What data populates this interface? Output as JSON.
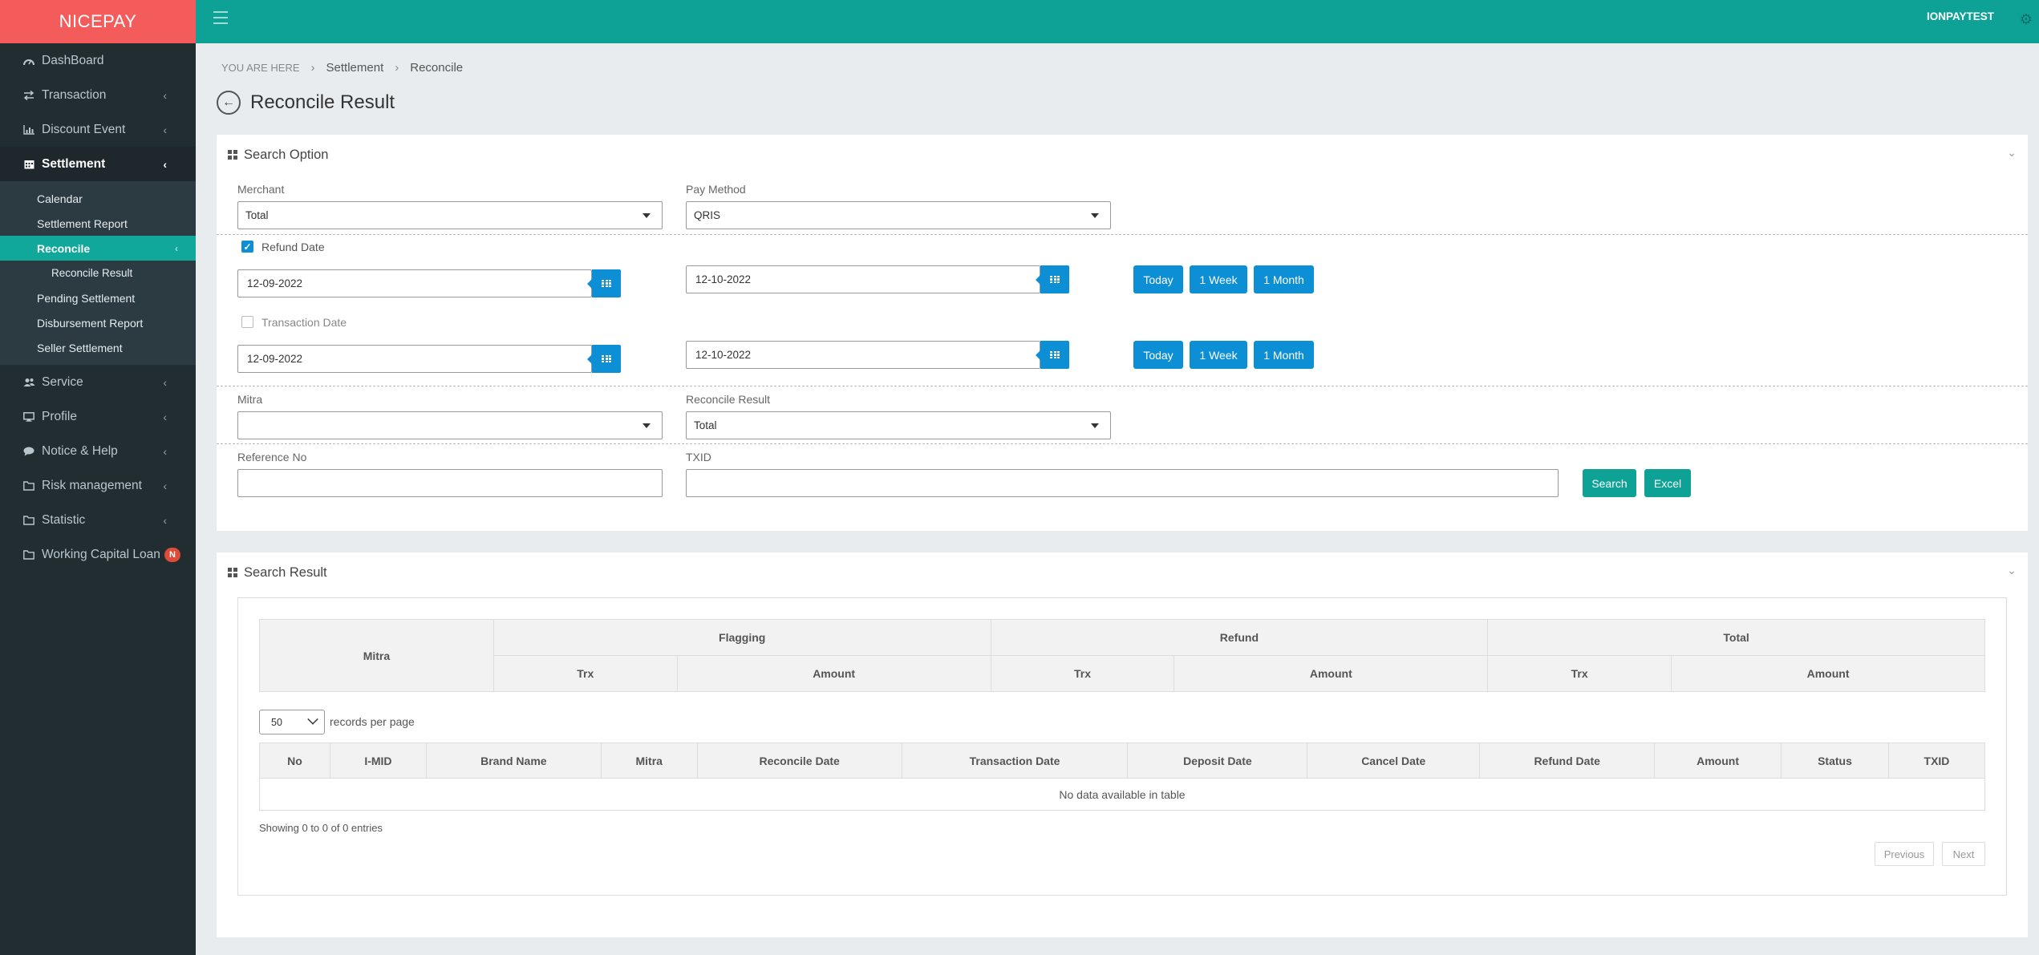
{
  "brand": "NICEPAY",
  "topbar": {
    "user": "IONPAYTEST"
  },
  "sidebar": {
    "items": [
      {
        "label": "DashBoard",
        "icon": "dashboard-icon"
      },
      {
        "label": "Transaction",
        "icon": "exchange-icon"
      },
      {
        "label": "Discount Event",
        "icon": "bar-chart-icon"
      },
      {
        "label": "Settlement",
        "icon": "calendar-icon"
      },
      {
        "label": "Service",
        "icon": "users-icon"
      },
      {
        "label": "Profile",
        "icon": "desktop-icon"
      },
      {
        "label": "Notice & Help",
        "icon": "comment-icon"
      },
      {
        "label": "Risk management",
        "icon": "folder-icon"
      },
      {
        "label": "Statistic",
        "icon": "folder-icon"
      },
      {
        "label": "Working Capital Loan",
        "icon": "folder-icon",
        "badge": "N"
      }
    ],
    "settlement_sub": [
      "Calendar",
      "Settlement Report",
      "Reconcile",
      "Reconcile Result",
      "Pending Settlement",
      "Disbursement Report",
      "Seller Settlement"
    ]
  },
  "breadcrumb": {
    "here": "YOU ARE HERE",
    "level1": "Settlement",
    "level2": "Reconcile"
  },
  "page_title": "Reconcile Result",
  "search_option": {
    "title": "Search Option",
    "merchant_label": "Merchant",
    "merchant_value": "Total",
    "pay_method_label": "Pay Method",
    "pay_method_value": "QRIS",
    "refund_date_label": "Refund Date",
    "refund_from": "12-09-2022",
    "refund_to": "12-10-2022",
    "transaction_date_label": "Transaction Date",
    "trx_from": "12-09-2022",
    "trx_to": "12-10-2022",
    "today": "Today",
    "week": "1 Week",
    "month": "1 Month",
    "mitra_label": "Mitra",
    "mitra_value": "",
    "reconcile_result_label": "Reconcile Result",
    "reconcile_result_value": "Total",
    "reference_label": "Reference No",
    "reference_value": "",
    "txid_label": "TXID",
    "txid_value": "",
    "search_btn": "Search",
    "excel_btn": "Excel"
  },
  "search_result": {
    "title": "Search Result",
    "summary": {
      "mitra": "Mitra",
      "groups": [
        "Flagging",
        "Refund",
        "Total"
      ],
      "sub": [
        "Trx",
        "Amount"
      ]
    },
    "records_per_page_value": "50",
    "records_per_page_label": "records per page",
    "columns": [
      "No",
      "I-MID",
      "Brand Name",
      "Mitra",
      "Reconcile Date",
      "Transaction Date",
      "Deposit Date",
      "Cancel Date",
      "Refund Date",
      "Amount",
      "Status",
      "TXID"
    ],
    "empty": "No data available in table",
    "info": "Showing 0 to 0 of 0 entries",
    "prev": "Previous",
    "next": "Next"
  }
}
